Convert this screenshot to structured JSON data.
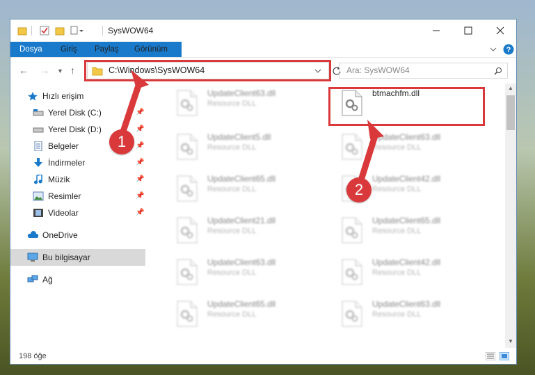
{
  "window": {
    "title": "SysWOW64"
  },
  "ribbon": {
    "tabs": [
      "Dosya",
      "Giriş",
      "Paylaş",
      "Görünüm"
    ]
  },
  "address": {
    "path": "C:\\Windows\\SysWOW64",
    "search_placeholder": "Ara: SysWOW64"
  },
  "sidebar": {
    "items": [
      {
        "label": "Hızlı erişim",
        "icon": "star-icon"
      },
      {
        "label": "Yerel Disk (C:)",
        "icon": "drive-icon",
        "pinned": true
      },
      {
        "label": "Yerel Disk (D:)",
        "icon": "drive-icon",
        "pinned": true
      },
      {
        "label": "Belgeler",
        "icon": "documents-icon",
        "pinned": true
      },
      {
        "label": "İndirmeler",
        "icon": "downloads-icon",
        "pinned": true
      },
      {
        "label": "Müzik",
        "icon": "music-icon",
        "pinned": true
      },
      {
        "label": "Resimler",
        "icon": "pictures-icon",
        "pinned": true
      },
      {
        "label": "Videolar",
        "icon": "videos-icon",
        "pinned": true
      },
      {
        "label": "OneDrive",
        "icon": "onedrive-icon"
      },
      {
        "label": "Bu bilgisayar",
        "icon": "computer-icon",
        "selected": true
      },
      {
        "label": "Ağ",
        "icon": "network-icon"
      }
    ]
  },
  "files": {
    "left": [
      "UpdateClient63.dll",
      "UpdateClient5.dll",
      "UpdateClient65.dll",
      "UpdateClient21.dll",
      "UpdateClient63.dll",
      "UpdateClient65.dll"
    ],
    "right": [
      "btmachfm.dll",
      "UpdateClient63.dll",
      "UpdateClient42.dll",
      "UpdateClient65.dll",
      "UpdateClient42.dll",
      "UpdateClient63.dll"
    ],
    "type": "Resource DLL"
  },
  "annotations": {
    "badge1": "1",
    "badge2": "2"
  },
  "status": {
    "count": "198 öğe"
  },
  "colors": {
    "accent": "#1979ca",
    "highlight": "#d9393b"
  }
}
